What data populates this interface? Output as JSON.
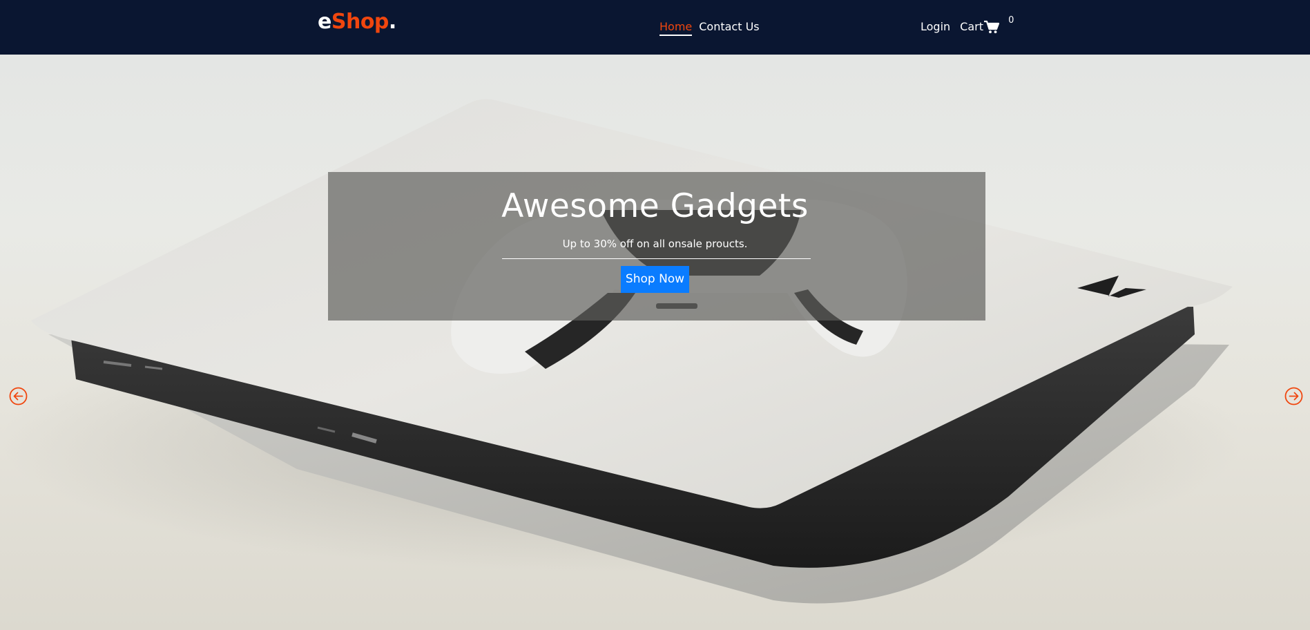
{
  "brand": {
    "part1": "e",
    "part2": "Shop",
    "part3": "."
  },
  "nav": {
    "links": [
      {
        "label": "Home",
        "active": true
      },
      {
        "label": "Contact Us",
        "active": false
      }
    ],
    "login_label": "Login",
    "cart_label": "Cart",
    "cart_count": "0",
    "cart_icon": "shopping-cart-icon"
  },
  "hero": {
    "title": "Awesome Gadgets",
    "subtitle": "Up to 30% off on all onsale proucts.",
    "cta_label": "Shop Now",
    "prev_icon": "arrow-left-circle-icon",
    "next_icon": "arrow-right-circle-icon"
  },
  "colors": {
    "navbar_bg": "#0a1631",
    "accent": "#f0460e",
    "button_bg": "#0a7cff"
  }
}
